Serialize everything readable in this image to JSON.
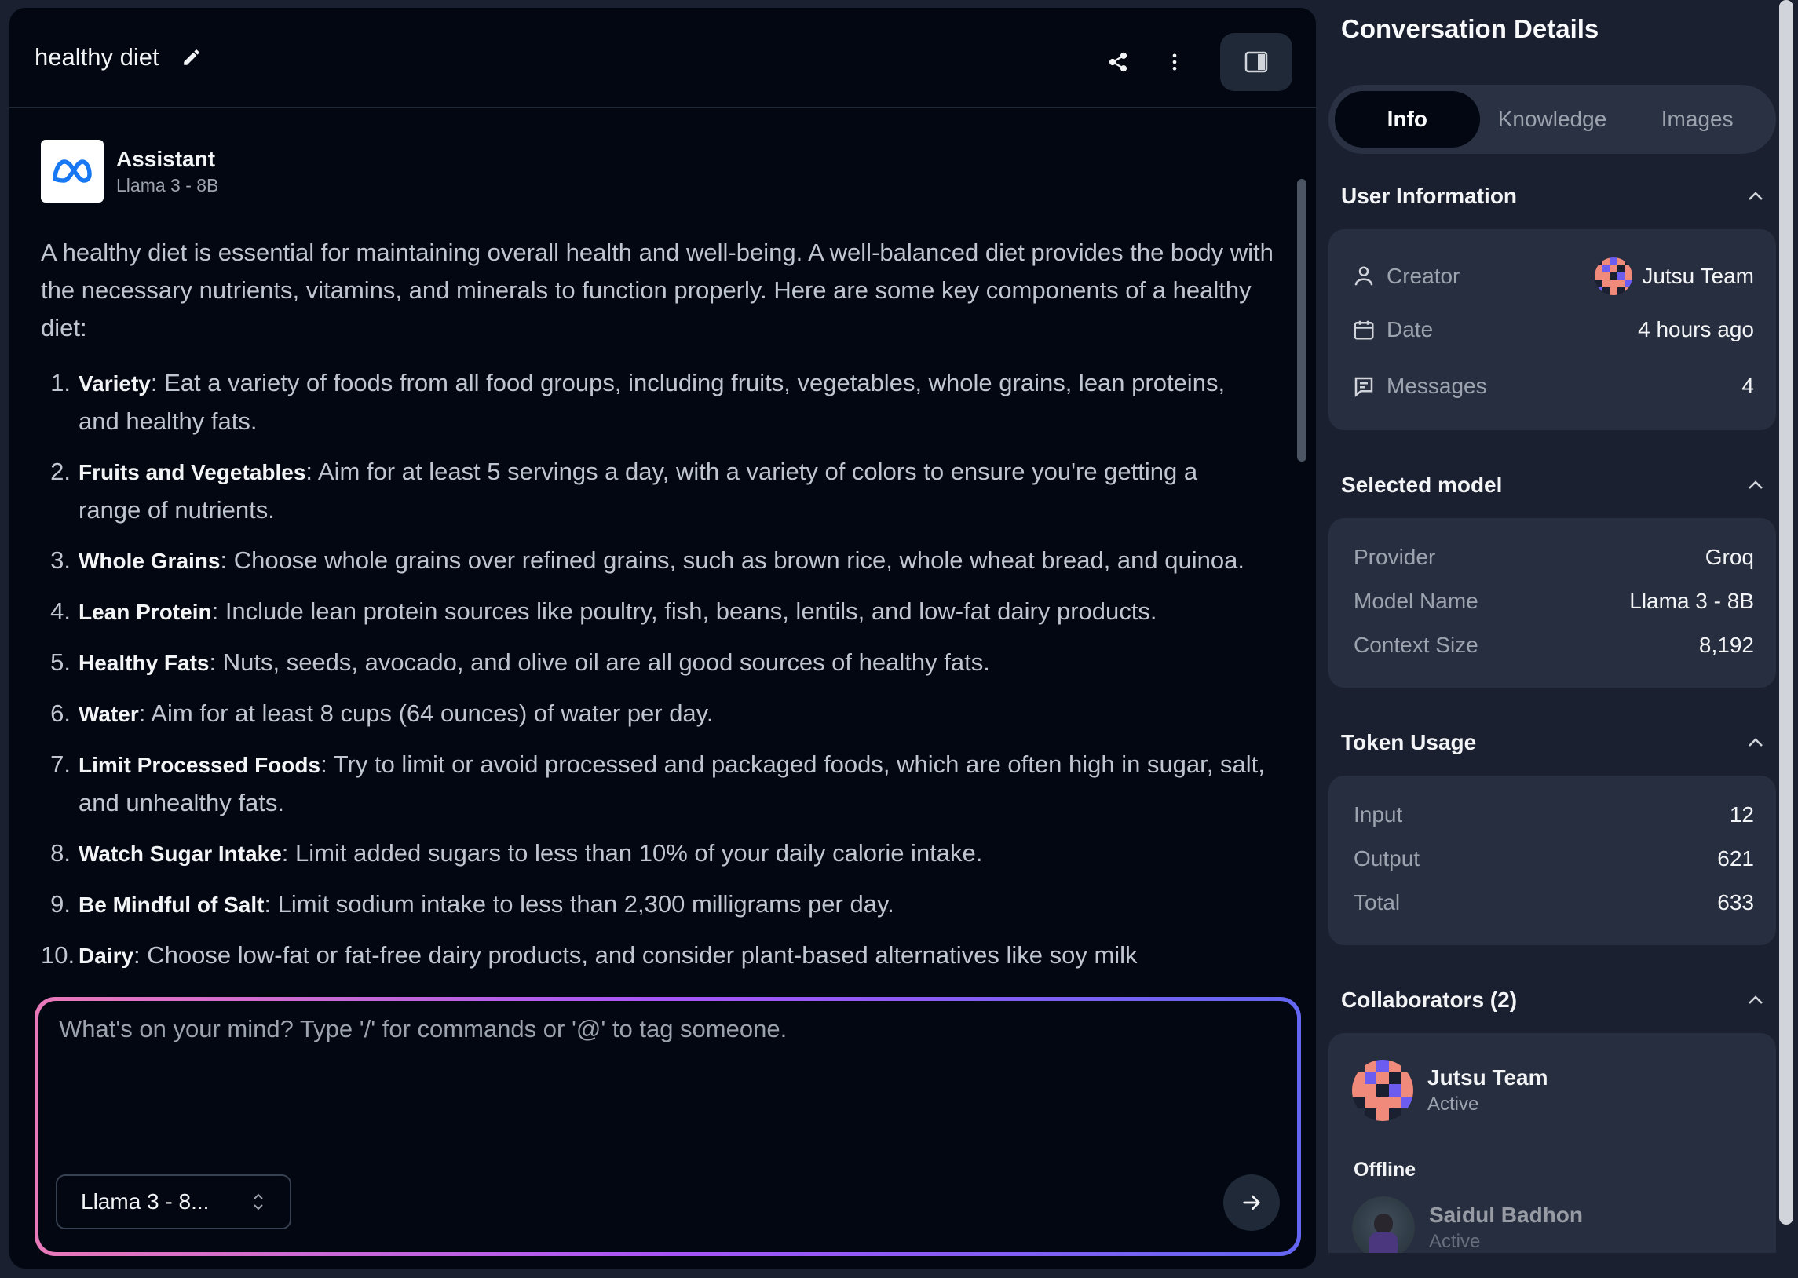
{
  "header": {
    "title": "healthy diet"
  },
  "assistant": {
    "name": "Assistant",
    "model": "Llama 3 - 8B"
  },
  "message": {
    "intro": "A healthy diet is essential for maintaining overall health and well-being. A well-balanced diet provides the body with the necessary nutrients, vitamins, and minerals to function properly. Here are some key components of a healthy diet:",
    "items": [
      {
        "num": "1.",
        "title": "Variety",
        "text": ": Eat a variety of foods from all food groups, including fruits, vegetables, whole grains, lean proteins, and healthy fats."
      },
      {
        "num": "2.",
        "title": "Fruits and Vegetables",
        "text": ": Aim for at least 5 servings a day, with a variety of colors to ensure you're getting a range of nutrients."
      },
      {
        "num": "3.",
        "title": "Whole Grains",
        "text": ": Choose whole grains over refined grains, such as brown rice, whole wheat bread, and quinoa."
      },
      {
        "num": "4.",
        "title": "Lean Protein",
        "text": ": Include lean protein sources like poultry, fish, beans, lentils, and low-fat dairy products."
      },
      {
        "num": "5.",
        "title": "Healthy Fats",
        "text": ": Nuts, seeds, avocado, and olive oil are all good sources of healthy fats."
      },
      {
        "num": "6.",
        "title": "Water",
        "text": ": Aim for at least 8 cups (64 ounces) of water per day."
      },
      {
        "num": "7.",
        "title": "Limit Processed Foods",
        "text": ": Try to limit or avoid processed and packaged foods, which are often high in sugar, salt, and unhealthy fats."
      },
      {
        "num": "8.",
        "title": "Watch Sugar Intake",
        "text": ": Limit added sugars to less than 10% of your daily calorie intake."
      },
      {
        "num": "9.",
        "title": "Be Mindful of Salt",
        "text": ": Limit sodium intake to less than 2,300 milligrams per day."
      },
      {
        "num": "10.",
        "title": "Dairy",
        "text": ": Choose low-fat or fat-free dairy products, and consider plant-based alternatives like soy milk"
      }
    ]
  },
  "composer": {
    "placeholder": "What's on your mind? Type '/' for commands or '@' to tag someone.",
    "model_select": "Llama 3 - 8..."
  },
  "details": {
    "title": "Conversation Details",
    "tabs": [
      "Info",
      "Knowledge",
      "Images"
    ],
    "user_info": {
      "heading": "User Information",
      "creator_label": "Creator",
      "creator_value": "Jutsu Team",
      "date_label": "Date",
      "date_value": "4 hours ago",
      "messages_label": "Messages",
      "messages_value": "4"
    },
    "selected_model": {
      "heading": "Selected model",
      "provider_label": "Provider",
      "provider_value": "Groq",
      "model_label": "Model Name",
      "model_value": "Llama 3 - 8B",
      "context_label": "Context Size",
      "context_value": "8,192"
    },
    "token_usage": {
      "heading": "Token Usage",
      "input_label": "Input",
      "input_value": "12",
      "output_label": "Output",
      "output_value": "621",
      "total_label": "Total",
      "total_value": "633"
    },
    "collaborators": {
      "heading": "Collaborators (2)",
      "active_name": "Jutsu Team",
      "active_status": "Active",
      "offline_label": "Offline",
      "offline_name": "Saidul Badhon",
      "offline_status": "Active"
    }
  },
  "colors": {
    "background": "#1b2030",
    "panel": "#030712",
    "card": "#272e3f",
    "gradient_start": "#e879b9",
    "gradient_end": "#6366f1",
    "meta_blue": "#1877f2"
  }
}
